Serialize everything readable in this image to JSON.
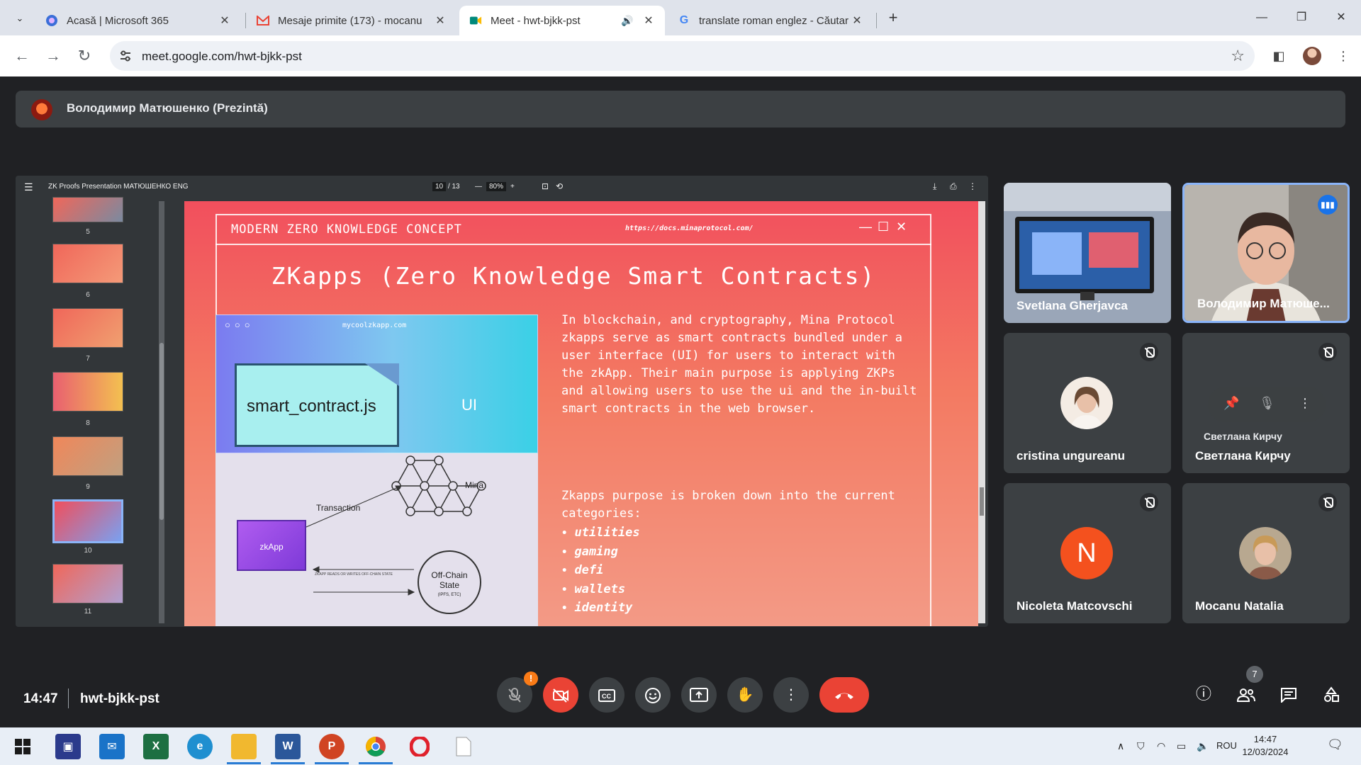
{
  "browser": {
    "tabs": [
      {
        "title": "Acasă | Microsoft 365",
        "active": false
      },
      {
        "title": "Mesaje primite (173) - mocanu",
        "active": false
      },
      {
        "title": "Meet - hwt-bjkk-pst",
        "active": true
      },
      {
        "title": "translate roman englez - Căutar",
        "active": false
      }
    ],
    "url": "meet.google.com/hwt-bjkk-pst"
  },
  "meet": {
    "presenter": "Володимир Матюшенко (Prezintă)",
    "clock": "14:47",
    "meeting_code": "hwt-bjkk-pst",
    "participant_count": "7"
  },
  "pdf": {
    "doc_title": "ZK Proofs Presentation МАТЮШЕНКО ENG",
    "page": "10",
    "page_total": "/ 13",
    "zoom": "80%",
    "thumbnails": [
      "5",
      "6",
      "7",
      "8",
      "9",
      "10",
      "11"
    ]
  },
  "slide": {
    "header": "MODERN ZERO KNOWLEDGE CONCEPT",
    "header_url": "https://docs.minaprotocol.com/",
    "title": "ZKapps (Zero Knowledge Smart Contracts)",
    "mock_url": "mycoolzkapp.com",
    "file_label": "smart_contract.js",
    "ui_label": "UI",
    "transaction": "Transaction",
    "mina": "Mina",
    "zkapp": "zkApp",
    "offchain_1": "Off-Chain",
    "offchain_2": "State",
    "offchain_3": "(IPFS, ETC)",
    "note": "ZKAPP READS OR WRITES OFF-CHAIN STATE",
    "paragraph": "In blockchain, and cryptography, Mina Protocol zkapps serve as smart contracts bundled under a user interface (UI) for users to interact with the zkApp. Their main purpose is applying ZKPs and allowing users to use the ui and the in-built smart contracts in the web browser.",
    "purpose": "Zkapps purpose is broken down into the current categories:",
    "categories": [
      "utilities",
      "gaming",
      "defi",
      "wallets",
      "identity"
    ]
  },
  "participants": [
    {
      "name": "Svetlana Gherjavca"
    },
    {
      "name": "Володимир Матюше..."
    },
    {
      "name": "cristina ungureanu"
    },
    {
      "name": "Светлана Кирчу",
      "hover_name": "Светлана Кирчу"
    },
    {
      "name": "Nicoleta Matcovschi",
      "initial": "N"
    },
    {
      "name": "Mocanu Natalia"
    }
  ],
  "taskbar": {
    "language": "ROU",
    "time": "14:47",
    "date": "12/03/2024"
  },
  "colors": {
    "meet_bg": "#202124",
    "tile_bg": "#3c4043",
    "end_call": "#ea4335",
    "active_speaker": "#8ab4f8"
  }
}
